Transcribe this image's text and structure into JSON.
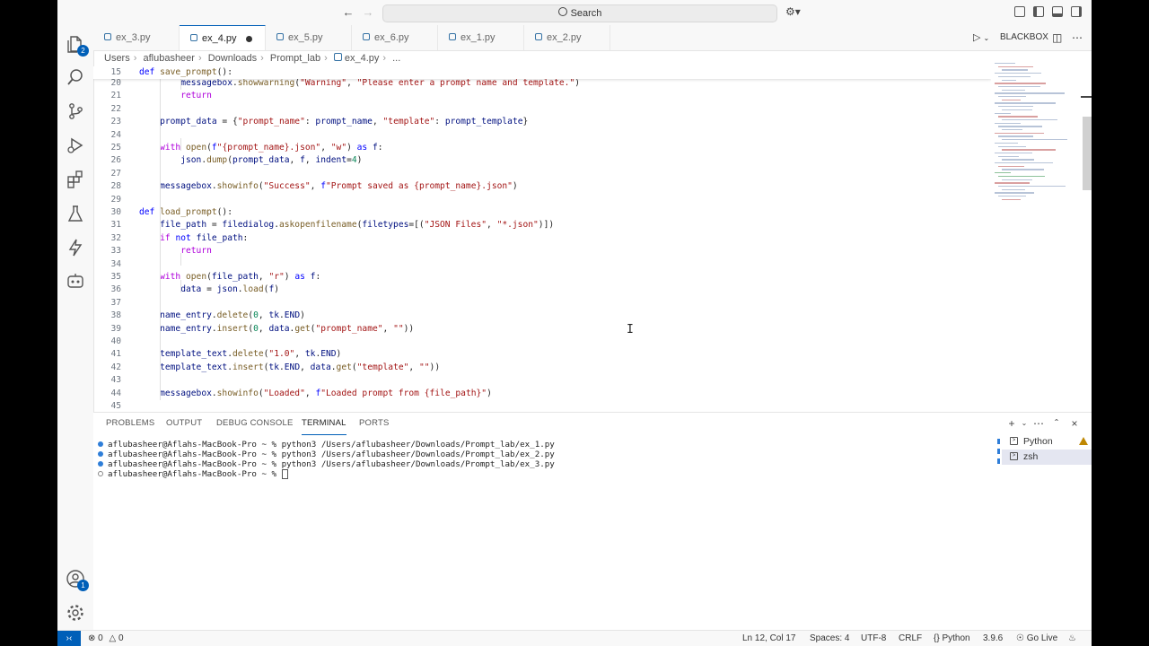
{
  "search": {
    "label": "Search"
  },
  "tabs": [
    {
      "label": "ex_3.py"
    },
    {
      "label": "ex_4.py"
    },
    {
      "label": "ex_5.py"
    },
    {
      "label": "ex_6.py"
    },
    {
      "label": "ex_1.py"
    },
    {
      "label": "ex_2.py"
    }
  ],
  "editor_actions": {
    "extension": "BLACKBOX"
  },
  "breadcrumb": [
    "Users",
    "aflubasheer",
    "Downloads",
    "Prompt_lab",
    "ex_4.py",
    "..."
  ],
  "activity": {
    "explorer_badge": "2",
    "accounts_badge": "1"
  },
  "code_lines": [
    {
      "n": "15",
      "t": "def save_prompt():"
    },
    {
      "n": "20",
      "t": "        messagebox.showwarning(\"Warning\", \"Please enter a prompt name and template.\")"
    },
    {
      "n": "21",
      "t": "        return"
    },
    {
      "n": "22",
      "t": ""
    },
    {
      "n": "23",
      "t": "    prompt_data = {\"prompt_name\": prompt_name, \"template\": prompt_template}"
    },
    {
      "n": "24",
      "t": ""
    },
    {
      "n": "25",
      "t": "    with open(f\"{prompt_name}.json\", \"w\") as f:"
    },
    {
      "n": "26",
      "t": "        json.dump(prompt_data, f, indent=4)"
    },
    {
      "n": "27",
      "t": ""
    },
    {
      "n": "28",
      "t": "    messagebox.showinfo(\"Success\", f\"Prompt saved as {prompt_name}.json\")"
    },
    {
      "n": "29",
      "t": ""
    },
    {
      "n": "30",
      "t": "def load_prompt():"
    },
    {
      "n": "31",
      "t": "    file_path = filedialog.askopenfilename(filetypes=[(\"JSON Files\", \"*.json\")])"
    },
    {
      "n": "32",
      "t": "    if not file_path:"
    },
    {
      "n": "33",
      "t": "        return"
    },
    {
      "n": "34",
      "t": ""
    },
    {
      "n": "35",
      "t": "    with open(file_path, \"r\") as f:"
    },
    {
      "n": "36",
      "t": "        data = json.load(f)"
    },
    {
      "n": "37",
      "t": ""
    },
    {
      "n": "38",
      "t": "    name_entry.delete(0, tk.END)"
    },
    {
      "n": "39",
      "t": "    name_entry.insert(0, data.get(\"prompt_name\", \"\"))"
    },
    {
      "n": "40",
      "t": ""
    },
    {
      "n": "41",
      "t": "    template_text.delete(\"1.0\", tk.END)"
    },
    {
      "n": "42",
      "t": "    template_text.insert(tk.END, data.get(\"template\", \"\"))"
    },
    {
      "n": "43",
      "t": ""
    },
    {
      "n": "44",
      "t": "    messagebox.showinfo(\"Loaded\", f\"Loaded prompt from {file_path}\")"
    },
    {
      "n": "45",
      "t": ""
    }
  ],
  "panel": {
    "tabs": [
      "PROBLEMS",
      "OUTPUT",
      "DEBUG CONSOLE",
      "TERMINAL",
      "PORTS"
    ],
    "active_tab": "TERMINAL",
    "terminal_lines": [
      "aflubasheer@Aflahs-MacBook-Pro ~ % python3 /Users/aflubasheer/Downloads/Prompt_lab/ex_1.py",
      "aflubasheer@Aflahs-MacBook-Pro ~ % python3 /Users/aflubasheer/Downloads/Prompt_lab/ex_2.py",
      "aflubasheer@Aflahs-MacBook-Pro ~ % python3 /Users/aflubasheer/Downloads/Prompt_lab/ex_3.py",
      "aflubasheer@Aflahs-MacBook-Pro ~ % "
    ],
    "terminals": [
      "Python",
      "zsh"
    ]
  },
  "status": {
    "errors": "0",
    "warnings": "0",
    "position": "Ln 12, Col 17",
    "spaces": "Spaces: 4",
    "encoding": "UTF-8",
    "eol": "CRLF",
    "language": "Python",
    "version": "3.9.6",
    "golive": "Go Live"
  },
  "colors": {
    "accent": "#005fb8",
    "keyword": "#0000ff",
    "control": "#af00db",
    "function": "#795e26",
    "string": "#a31515",
    "variable": "#001080",
    "number": "#098658"
  }
}
